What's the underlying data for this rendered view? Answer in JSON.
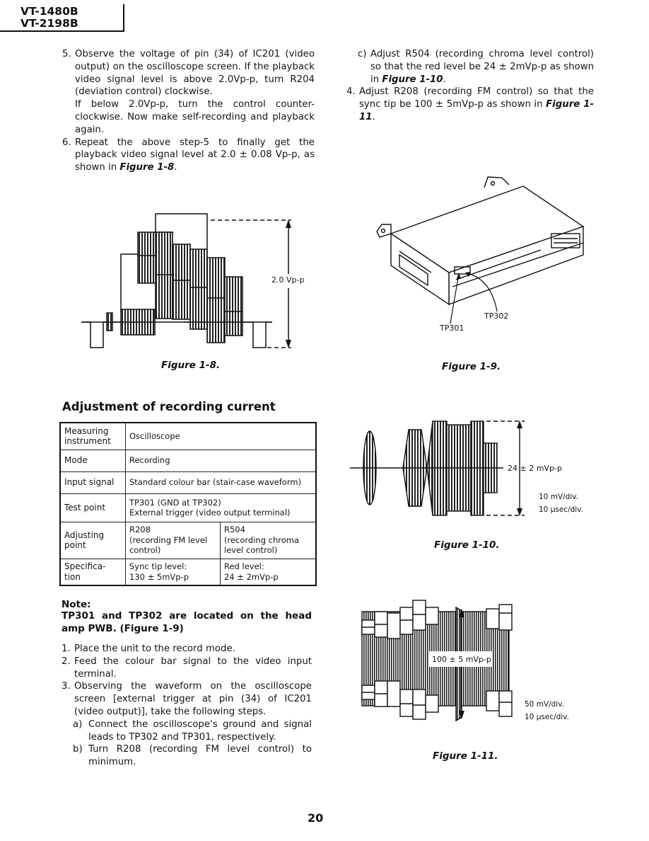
{
  "header": {
    "models": [
      "VT-1480B",
      "VT-2198B"
    ]
  },
  "left_column_top": {
    "steps": [
      {
        "num": "5.",
        "text": "Observe the voltage of pin (34) of IC201 (video output) on the oscilloscope screen.  If the playback video signal level is above 2.0Vp-p, turn R204 (deviation control) clockwise.",
        "text2": "If below 2.0Vp-p,  turn the control counter-clockwise.  Now make self-recording and playback again."
      },
      {
        "num": "6.",
        "text": "Repeat the above step-5 to finally get the playback video signal level at 2.0 ± 0.08 Vp-p, as shown in ",
        "ref": "Figure 1-8",
        "tail": "."
      }
    ]
  },
  "right_column_top": {
    "steps": [
      {
        "num": "c)",
        "text": "Adjust R504 (recording chroma level control) so that the red level be 24 ± 2mVp-p as shown in ",
        "ref": "Figure 1-10",
        "tail": "."
      },
      {
        "num": "4.",
        "text": "Adjust R208 (recording FM control) so that the sync tip be 100 ± 5mVp-p as  shown  in ",
        "ref": "Figure 1-11",
        "tail": "."
      }
    ]
  },
  "figures": {
    "fig_1_8": {
      "caption": "Figure 1-8.",
      "label": "2.0 Vp-p"
    },
    "fig_1_9": {
      "caption": "Figure 1-9.",
      "labels": {
        "tp301": "TP301",
        "tp302": "TP302"
      }
    },
    "fig_1_10": {
      "caption": "Figure 1-10.",
      "label": "24 ± 2 mVp-p",
      "scale_v": "10 mV/div.",
      "scale_t": "10 µsec/div."
    },
    "fig_1_11": {
      "caption": "Figure 1-11.",
      "label": "100 ± 5 mVp-p",
      "scale_v": "50 mV/div.",
      "scale_t": "10 µsec/div."
    }
  },
  "section": {
    "title": "Adjustment of recording current"
  },
  "spec_table": {
    "rows": [
      {
        "label": "Measuring instrument",
        "value": "Oscilloscope"
      },
      {
        "label": "Mode",
        "value": "Recording"
      },
      {
        "label": "Input signal",
        "value": "Standard colour bar (stair-case waveform)"
      },
      {
        "label": "Test point",
        "value": "TP301 (GND at TP302)",
        "value2": "External trigger (video output terminal)"
      },
      {
        "label": "Adjusting point",
        "col1": "R208",
        "col1b": "(recording FM level control)",
        "col2": "R504",
        "col2b": "(recording chroma level control)"
      },
      {
        "label": "Specifica-tion",
        "col1": "Sync tip level:",
        "col1b": "130 ± 5mVp-p",
        "col2": "Red level:",
        "col2b": "24 ± 2mVp-p"
      }
    ]
  },
  "note": {
    "title": "Note:",
    "body": "TP301 and TP302 are located on the head amp PWB. (Figure 1-9)"
  },
  "procedure": {
    "steps": [
      {
        "num": "1.",
        "text": "Place the unit to the record mode."
      },
      {
        "num": "2.",
        "text": "Feed the colour bar signal to the video input terminal."
      },
      {
        "num": "3.",
        "text": "Observing the waveform on the oscilloscope screen [external trigger at  pin (34) of IC201 (video output)], take the following steps."
      }
    ],
    "substeps": [
      {
        "num": "a)",
        "text": "Connect the oscilloscope's ground and signal leads to TP302 and TP301, respectively."
      },
      {
        "num": "b)",
        "text": "Turn R208 (recording FM level control) to minimum."
      }
    ]
  },
  "footer": {
    "page_number": "20"
  }
}
